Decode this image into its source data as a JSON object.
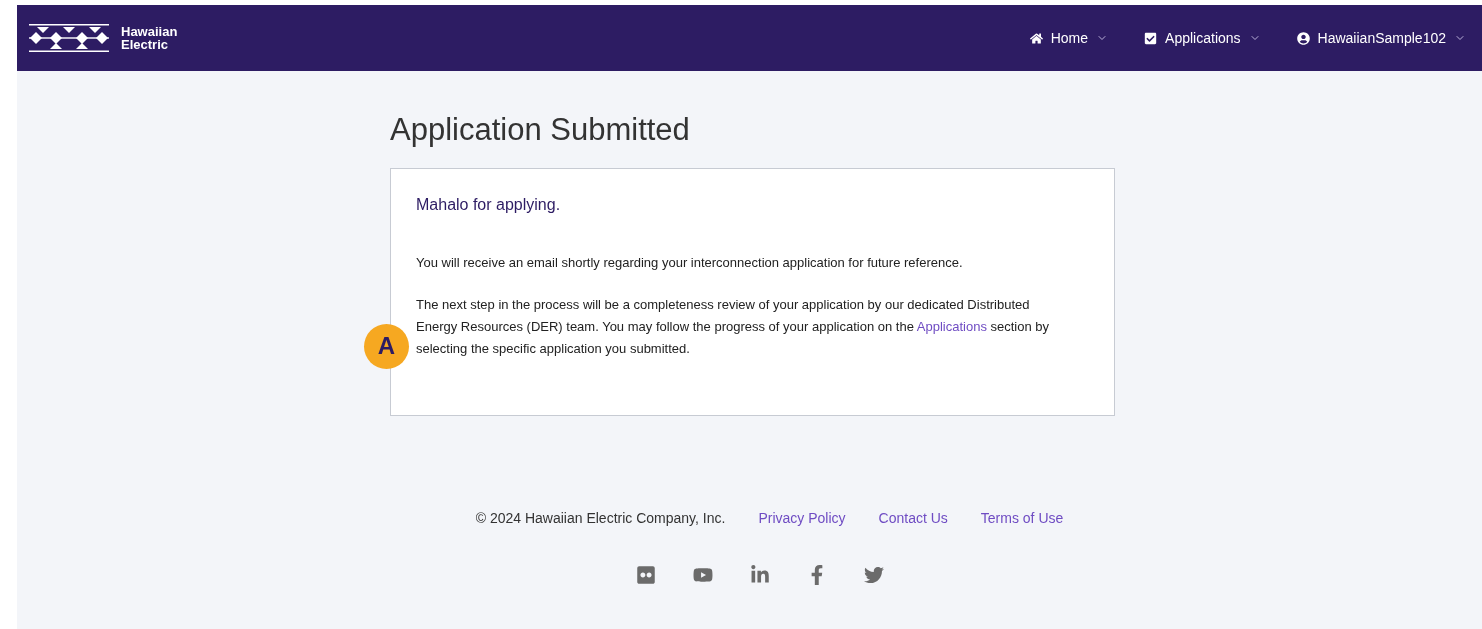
{
  "header": {
    "logo_text": [
      "Hawaiian",
      "Electric"
    ],
    "nav": [
      {
        "kind": "home",
        "label": "Home"
      },
      {
        "kind": "applications",
        "label": "Applications"
      },
      {
        "kind": "user",
        "label": "HawaiianSample102"
      }
    ]
  },
  "page": {
    "title": "Application Submitted",
    "card": {
      "heading": "Mahalo for applying.",
      "paragraph_1": "You will receive an email shortly regarding your interconnection application for future reference.",
      "paragraph_2": "The next step in the process will be a completeness review of your application by our dedicated Distributed Energy Resources (DER) team. You may follow the progress of your application on the",
      "link": "Applications",
      "paragraph_2_end": "section by selecting the specific application you submitted.",
      "callout": "A"
    }
  },
  "footer": {
    "copyright": "© 2024 Hawaiian Electric Company, Inc.",
    "links": [
      "Privacy Policy",
      "Contact Us",
      "Terms of Use"
    ],
    "social": [
      {
        "kind": "flickr"
      },
      {
        "kind": "youtube"
      },
      {
        "kind": "linkedin"
      },
      {
        "kind": "facebook"
      },
      {
        "kind": "twitter"
      }
    ]
  }
}
